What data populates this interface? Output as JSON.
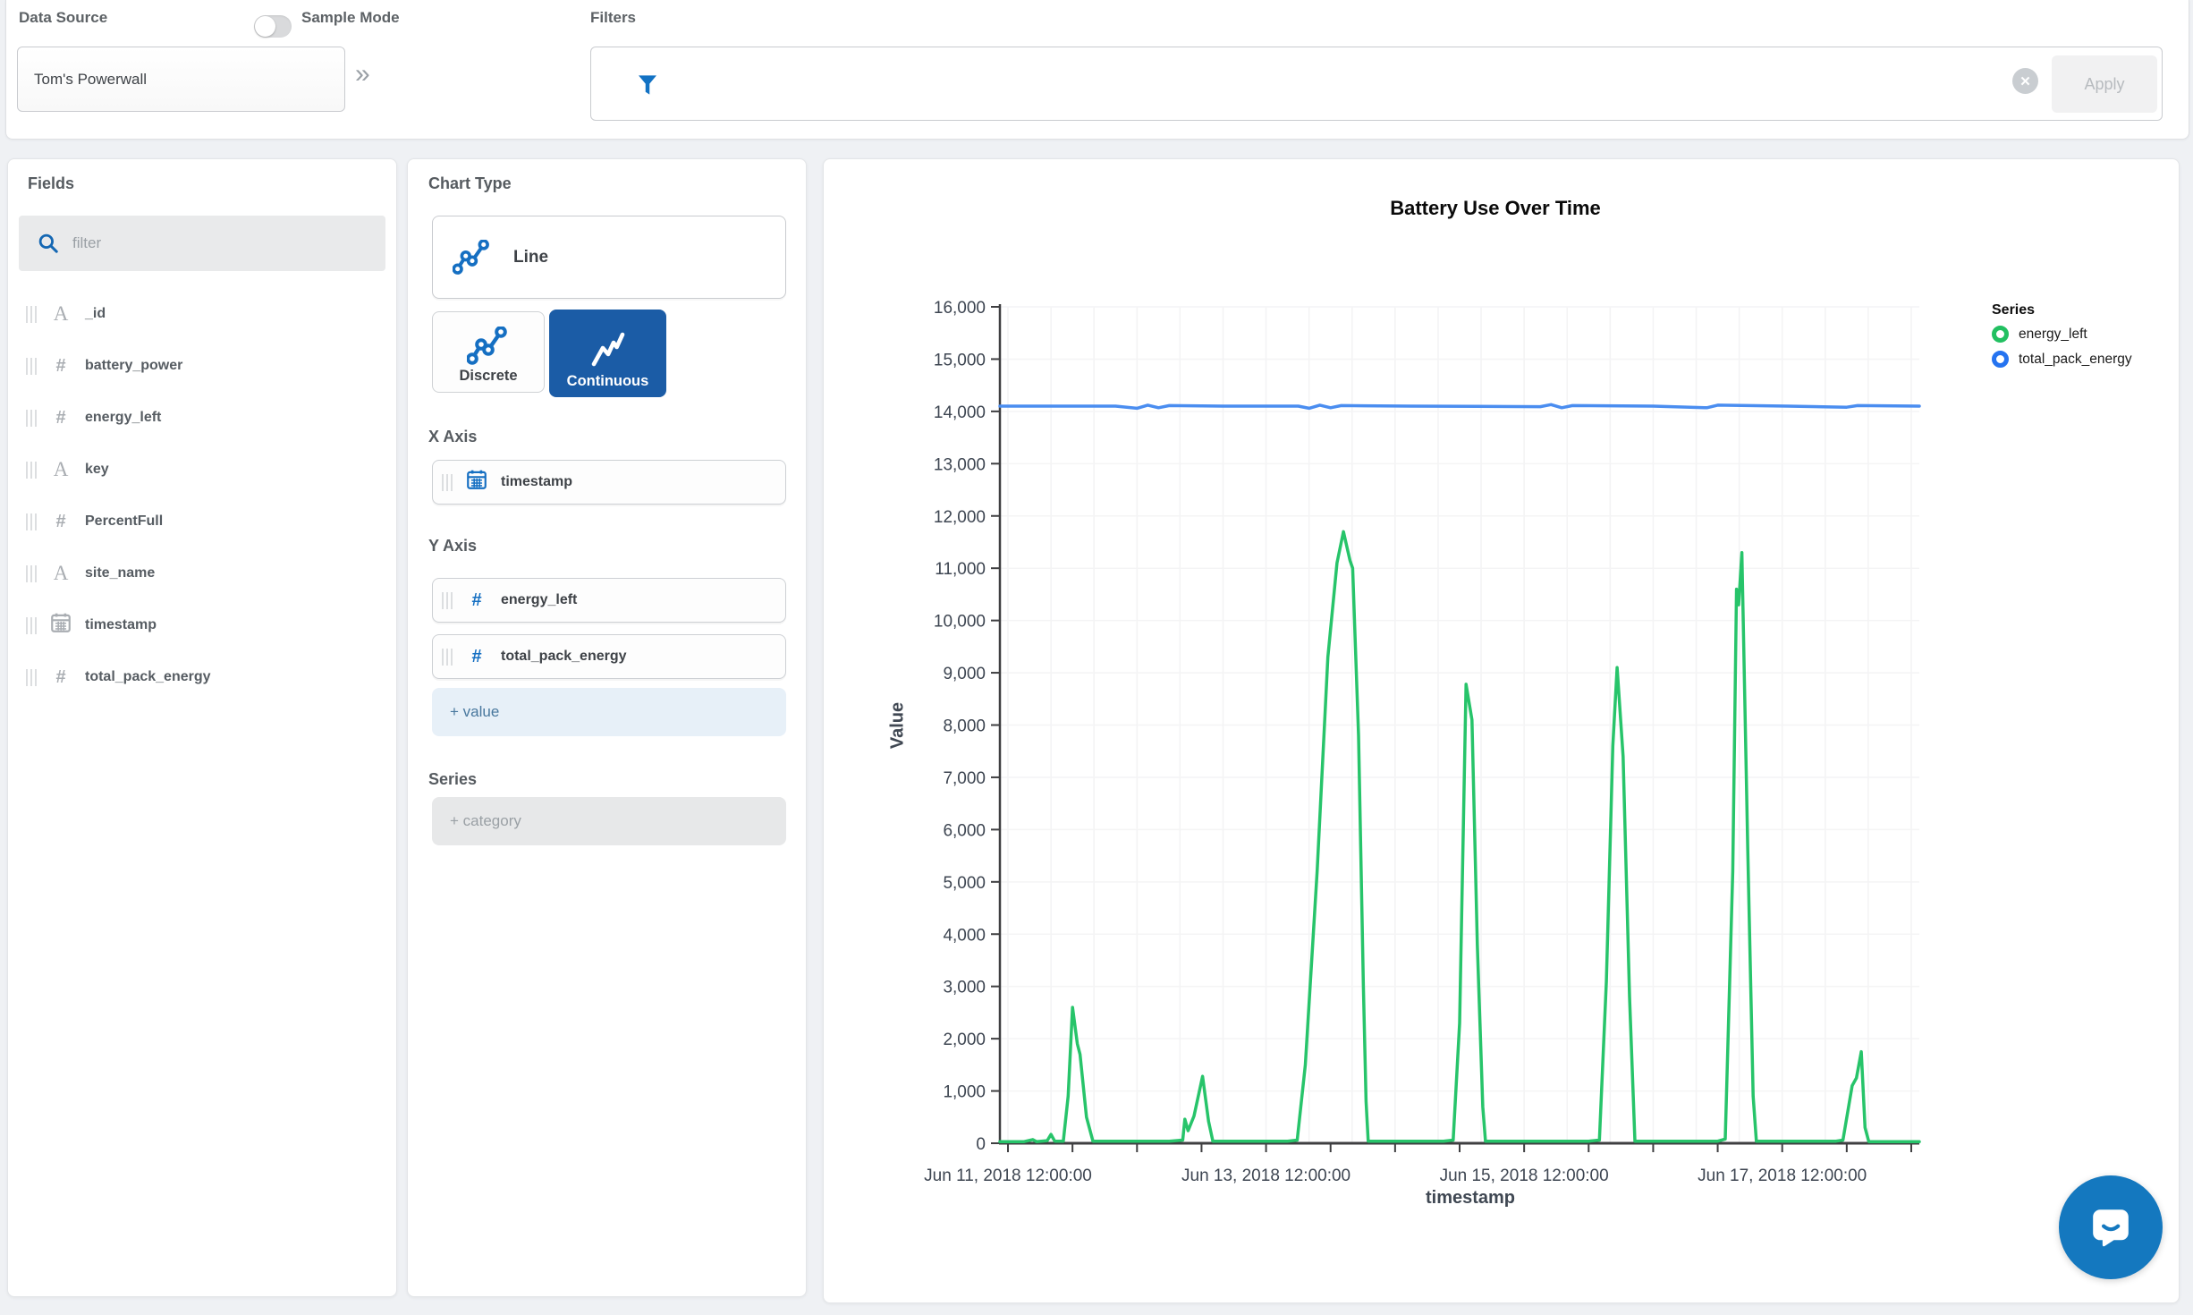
{
  "topbar": {
    "data_source_label": "Data Source",
    "data_source_value": "Tom's Powerwall",
    "sample_mode_label": "Sample Mode",
    "sample_mode_on": false,
    "filters_label": "Filters",
    "filters_value": "",
    "apply_label": "Apply"
  },
  "icons": {
    "collapse_glyph": "»",
    "clear_glyph": "✕",
    "funnel": "filter-funnel",
    "search": "magnifier",
    "chat": "speech-bubble-smile",
    "string_field": "A",
    "number_field": "#",
    "date_field": "calendar"
  },
  "fields_panel": {
    "title": "Fields",
    "filter_placeholder": "filter",
    "items": [
      {
        "name": "_id",
        "type": "string"
      },
      {
        "name": "battery_power",
        "type": "number"
      },
      {
        "name": "energy_left",
        "type": "number"
      },
      {
        "name": "key",
        "type": "string"
      },
      {
        "name": "PercentFull",
        "type": "number"
      },
      {
        "name": "site_name",
        "type": "string"
      },
      {
        "name": "timestamp",
        "type": "date"
      },
      {
        "name": "total_pack_energy",
        "type": "number"
      }
    ]
  },
  "encoding_panel": {
    "chart_type_label": "Chart Type",
    "chart_type_value": "Line",
    "discrete_label": "Discrete",
    "continuous_label": "Continuous",
    "selected_mode": "Continuous",
    "x_axis_label": "X Axis",
    "x_axis_field": {
      "name": "timestamp",
      "type": "date"
    },
    "y_axis_label": "Y Axis",
    "y_axis_fields": [
      {
        "name": "energy_left",
        "type": "number"
      },
      {
        "name": "total_pack_energy",
        "type": "number"
      }
    ],
    "add_value_label": "+ value",
    "series_label": "Series",
    "add_category_label": "+ category"
  },
  "colors": {
    "accent_blue": "#156fc2",
    "selected_button_blue": "#1b5ca6",
    "series_green": "#27c46a",
    "series_blue": "#4a8df0",
    "legend_green": "#22c061",
    "legend_blue": "#2573f0",
    "chat_blue": "#1478bf"
  },
  "chart_data": {
    "type": "line",
    "title": "Battery Use Over Time",
    "xlabel": "timestamp",
    "ylabel": "Value",
    "x_axis_kind": "time",
    "x_origin": "Jun 11, 2018 12:00:00",
    "x_unit": "hours_since_origin",
    "xlim": [
      -1.5,
      169.5
    ],
    "ylim": [
      0,
      16000
    ],
    "y_tick_step": 1000,
    "x_labeled_ticks": [
      {
        "h": 0,
        "label": "Jun 11, 2018 12:00:00"
      },
      {
        "h": 48,
        "label": "Jun 13, 2018 12:00:00"
      },
      {
        "h": 96,
        "label": "Jun 15, 2018 12:00:00"
      },
      {
        "h": 144,
        "label": "Jun 17, 2018 12:00:00"
      }
    ],
    "x_minor_tick_hours": 12,
    "x_grid_hours": 8,
    "grid": true,
    "legend_title": "Series",
    "legend_position": "right",
    "series": [
      {
        "name": "energy_left",
        "color": "#27c46a",
        "legend_color": "#22c061",
        "points": [
          [
            -1.5,
            30
          ],
          [
            3,
            30
          ],
          [
            4.6,
            70
          ],
          [
            5.3,
            30
          ],
          [
            7.3,
            50
          ],
          [
            8,
            170
          ],
          [
            8.7,
            40
          ],
          [
            10.3,
            40
          ],
          [
            11.2,
            900
          ],
          [
            12,
            2600
          ],
          [
            12.9,
            1900
          ],
          [
            13.4,
            1700
          ],
          [
            14.6,
            500
          ],
          [
            15.8,
            40
          ],
          [
            30,
            40
          ],
          [
            32.5,
            60
          ],
          [
            32.9,
            460
          ],
          [
            33.5,
            240
          ],
          [
            34.6,
            520
          ],
          [
            36.2,
            1280
          ],
          [
            37.3,
            420
          ],
          [
            38.1,
            40
          ],
          [
            52,
            40
          ],
          [
            53.8,
            60
          ],
          [
            55.3,
            1500
          ],
          [
            57.5,
            5200
          ],
          [
            59.5,
            9300
          ],
          [
            61.2,
            11100
          ],
          [
            62.4,
            11700
          ],
          [
            63.6,
            11150
          ],
          [
            64.1,
            11000
          ],
          [
            65.2,
            7800
          ],
          [
            66.1,
            3000
          ],
          [
            66.6,
            800
          ],
          [
            67,
            40
          ],
          [
            81,
            40
          ],
          [
            82.8,
            60
          ],
          [
            84,
            2300
          ],
          [
            85.2,
            8780
          ],
          [
            86.3,
            8100
          ],
          [
            87.3,
            3800
          ],
          [
            88.3,
            700
          ],
          [
            88.8,
            40
          ],
          [
            108,
            40
          ],
          [
            110,
            60
          ],
          [
            111.3,
            3100
          ],
          [
            112.5,
            7600
          ],
          [
            113.3,
            9100
          ],
          [
            114.4,
            7400
          ],
          [
            115.6,
            2800
          ],
          [
            116.6,
            40
          ],
          [
            132,
            40
          ],
          [
            133.4,
            80
          ],
          [
            134.8,
            5200
          ],
          [
            135.5,
            10600
          ],
          [
            135.9,
            10300
          ],
          [
            136.5,
            11300
          ],
          [
            137.6,
            5600
          ],
          [
            138.6,
            900
          ],
          [
            139.2,
            40
          ],
          [
            154,
            40
          ],
          [
            155.3,
            60
          ],
          [
            157,
            1100
          ],
          [
            157.8,
            1250
          ],
          [
            158.7,
            1750
          ],
          [
            159.4,
            300
          ],
          [
            160.1,
            30
          ],
          [
            169.5,
            30
          ]
        ]
      },
      {
        "name": "total_pack_energy",
        "color": "#4a8df0",
        "legend_color": "#2573f0",
        "points": [
          [
            -1.5,
            14100
          ],
          [
            20,
            14100
          ],
          [
            24,
            14060
          ],
          [
            26,
            14120
          ],
          [
            28,
            14070
          ],
          [
            30,
            14110
          ],
          [
            40,
            14100
          ],
          [
            54,
            14100
          ],
          [
            56,
            14060
          ],
          [
            58,
            14120
          ],
          [
            60,
            14070
          ],
          [
            62,
            14110
          ],
          [
            75,
            14100
          ],
          [
            99,
            14090
          ],
          [
            101,
            14130
          ],
          [
            103,
            14070
          ],
          [
            105,
            14110
          ],
          [
            120,
            14100
          ],
          [
            130,
            14070
          ],
          [
            132,
            14120
          ],
          [
            145,
            14100
          ],
          [
            156,
            14080
          ],
          [
            158,
            14110
          ],
          [
            169.5,
            14100
          ]
        ]
      }
    ]
  }
}
